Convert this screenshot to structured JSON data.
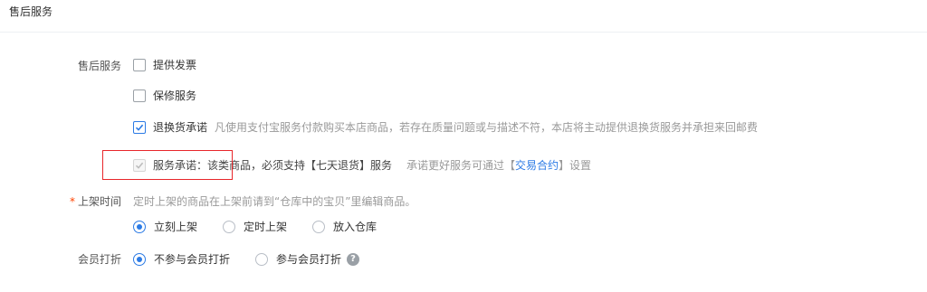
{
  "section": {
    "title": "售后服务"
  },
  "after_sales": {
    "label": "售后服务",
    "options": [
      {
        "label": "提供发票",
        "checked": false
      },
      {
        "label": "保修服务",
        "checked": false
      },
      {
        "label": "退换货承诺",
        "checked": true,
        "note": "凡使用支付宝服务付款购买本店商品，若存在质量问题或与描述不符，本店将主动提供退换货服务并承担来回邮费"
      }
    ],
    "service_promise": {
      "label": "服务承诺：该类商品，必须支持【七天退货】服务",
      "checked": true,
      "disabled": true,
      "note_prefix": "承诺更好服务可通过【",
      "note_link": "交易合约",
      "note_suffix": "】设置"
    }
  },
  "listing_time": {
    "required_mark": "*",
    "label": "上架时间",
    "hint": "定时上架的商品在上架前请到“仓库中的宝贝”里编辑商品。",
    "options": [
      {
        "label": "立刻上架",
        "selected": true
      },
      {
        "label": "定时上架",
        "selected": false
      },
      {
        "label": "放入仓库",
        "selected": false
      }
    ]
  },
  "member_discount": {
    "label": "会员打折",
    "options": [
      {
        "label": "不参与会员打折",
        "selected": true
      },
      {
        "label": "参与会员打折",
        "selected": false
      }
    ],
    "help_icon": "question-circle-icon"
  },
  "colors": {
    "accent": "#2c7be5",
    "highlight_border": "#e8262a",
    "required": "#ff4400"
  }
}
